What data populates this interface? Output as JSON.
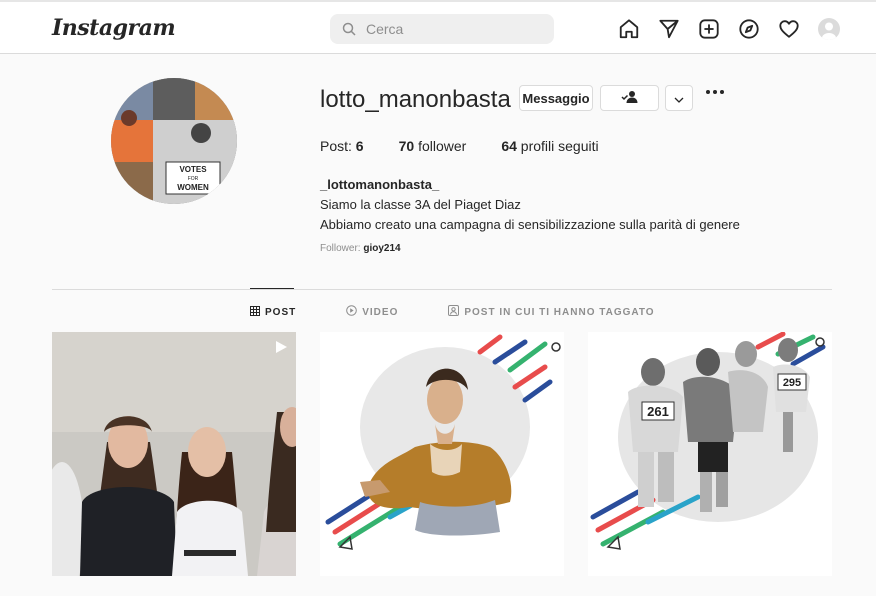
{
  "header": {
    "logo": "Instagram",
    "search_placeholder": "Cerca"
  },
  "nav": {
    "icons": [
      "home-icon",
      "send-icon",
      "new-post-icon",
      "explore-icon",
      "heart-icon",
      "profile-avatar"
    ]
  },
  "profile": {
    "username": "lotto_manonbasta",
    "message_button": "Messaggio",
    "stats": {
      "posts_label": "Post:",
      "posts_count": "6",
      "followers_count": "70",
      "followers_label": "follower",
      "following_count": "64",
      "following_label": "profili seguiti"
    },
    "bio": {
      "name": "_lottomanonbasta_",
      "line1": "Siamo la classe 3A del Piaget Diaz",
      "line2": "Abbiamo creato una campagna di sensibilizzazione sulla parità di genere"
    },
    "followed_by_label": "Follower:",
    "followed_by_user": "gioy214",
    "picture_text": "VOTES FOR WOMEN"
  },
  "tabs": [
    {
      "label": "POST",
      "active": true
    },
    {
      "label": "VIDEO",
      "active": false
    },
    {
      "label": "POST IN CUI TI HANNO TAGGATO",
      "active": false
    }
  ],
  "posts": [
    {
      "type": "video"
    },
    {
      "type": "image"
    },
    {
      "type": "image",
      "bibs": [
        "261",
        "295"
      ]
    }
  ]
}
